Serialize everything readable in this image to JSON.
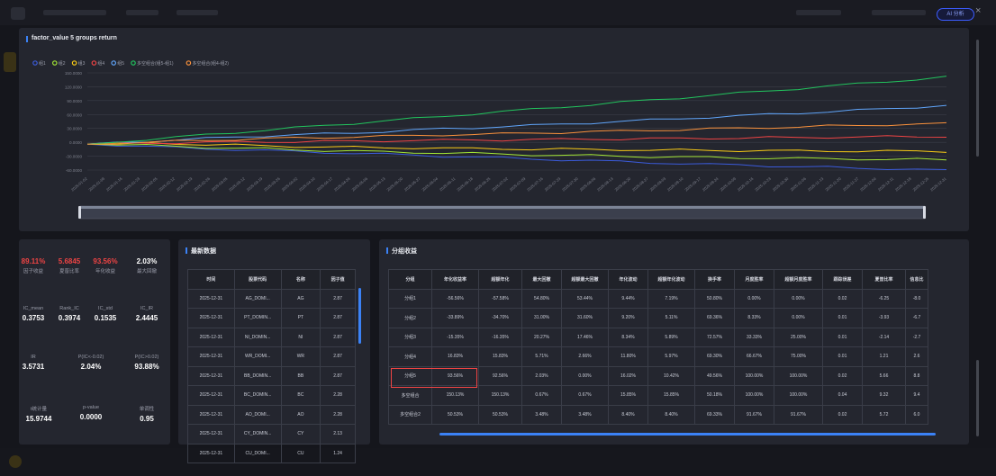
{
  "modal": {
    "analyze_label": "AI 分析",
    "close": "×"
  },
  "chart": {
    "title": "factor_value 5 groups return",
    "legend": [
      "组1",
      "组2",
      "组3",
      "组4",
      "组5",
      "多空组合(组5-组1)",
      "多空组合(组4-组2)"
    ],
    "y_ticks": [
      "150.0000",
      "120.0000",
      "90.0000",
      "60.0000",
      "30.0000",
      "0.0000",
      "-30.0000",
      "-60.0000"
    ],
    "x_ticks": [
      "2025-01-02",
      "2025-01-09",
      "2025-01-16",
      "2025-01-23",
      "2025-02-05",
      "2025-02-12",
      "2025-02-19",
      "2025-02-26",
      "2025-03-05",
      "2025-03-12",
      "2025-03-19",
      "2025-03-26",
      "2025-04-02",
      "2025-04-10",
      "2025-04-17",
      "2025-04-24",
      "2025-05-06",
      "2025-05-13",
      "2025-05-20",
      "2025-05-27",
      "2025-06-04",
      "2025-06-11",
      "2025-06-18",
      "2025-06-25",
      "2025-07-02",
      "2025-07-09",
      "2025-07-16",
      "2025-07-23",
      "2025-07-30",
      "2025-08-06",
      "2025-08-13",
      "2025-08-20",
      "2025-08-27",
      "2025-09-03",
      "2025-09-10",
      "2025-09-17",
      "2025-09-24",
      "2025-10-09",
      "2025-10-16",
      "2025-10-23",
      "2025-10-30",
      "2025-11-06",
      "2025-11-13",
      "2025-11-20",
      "2025-11-27",
      "2025-12-04",
      "2025-12-11",
      "2025-12-18",
      "2025-12-25",
      "2025-12-31"
    ]
  },
  "chart_data": {
    "type": "line",
    "title": "factor_value 5 groups return",
    "ylim": [
      -60,
      150
    ],
    "x_start": "2025-01-02",
    "x_end": "2025-12-31",
    "series": [
      {
        "name": "组1",
        "color": "#3b5bdb",
        "values": [
          0,
          -2,
          -5,
          -8,
          -10,
          -12,
          -14,
          -16,
          -18,
          -20,
          -22,
          -24,
          -26,
          -28,
          -30,
          -32,
          -34,
          -36,
          -38,
          -40,
          -42,
          -44,
          -45,
          -47,
          -49,
          -50,
          -52,
          -53,
          -55,
          -57
        ]
      },
      {
        "name": "组2",
        "color": "#a3e635",
        "values": [
          0,
          -1,
          -3,
          -5,
          -7,
          -9,
          -10,
          -12,
          -14,
          -15,
          -17,
          -18,
          -19,
          -20,
          -22,
          -23,
          -24,
          -25,
          -26,
          -27,
          -28,
          -29,
          -30,
          -30,
          -31,
          -32,
          -32,
          -33,
          -33,
          -34
        ]
      },
      {
        "name": "组3",
        "color": "#facc15",
        "values": [
          0,
          1,
          2,
          1,
          -1,
          -2,
          -4,
          -5,
          -6,
          -7,
          -8,
          -8,
          -9,
          -10,
          -10,
          -11,
          -11,
          -12,
          -12,
          -13,
          -13,
          -14,
          -14,
          -14,
          -15,
          -15,
          -15,
          -15,
          -16,
          -16
        ]
      },
      {
        "name": "组4",
        "color": "#ef4444",
        "values": [
          0,
          1,
          2,
          3,
          4,
          4,
          5,
          5,
          6,
          6,
          7,
          8,
          8,
          9,
          9,
          10,
          10,
          11,
          11,
          12,
          12,
          13,
          13,
          14,
          14,
          15,
          15,
          16,
          16,
          17
        ]
      },
      {
        "name": "组5",
        "color": "#60a5fa",
        "values": [
          0,
          3,
          6,
          9,
          12,
          15,
          18,
          20,
          22,
          24,
          27,
          30,
          33,
          35,
          38,
          40,
          43,
          46,
          49,
          52,
          55,
          58,
          61,
          64,
          67,
          70,
          73,
          76,
          80,
          84
        ]
      },
      {
        "name": "多空组合(组5-组1)",
        "color": "#22c55e",
        "values": [
          0,
          5,
          10,
          15,
          20,
          25,
          30,
          35,
          40,
          45,
          50,
          55,
          60,
          65,
          70,
          75,
          80,
          85,
          90,
          95,
          100,
          105,
          110,
          115,
          120,
          125,
          130,
          135,
          140,
          145
        ]
      },
      {
        "name": "多空组合(组4-组2)",
        "color": "#fb923c",
        "values": [
          0,
          2,
          4,
          6,
          8,
          10,
          12,
          13,
          14,
          16,
          17,
          18,
          20,
          21,
          22,
          24,
          25,
          27,
          28,
          30,
          31,
          33,
          34,
          36,
          37,
          39,
          40,
          42,
          43,
          44
        ]
      }
    ]
  },
  "stats": [
    {
      "value": "89.11%",
      "label": "因子收益",
      "red": true
    },
    {
      "value": "5.6845",
      "label": "夏普比率",
      "red": true
    },
    {
      "value": "93.56%",
      "label": "年化收益",
      "red": true
    },
    {
      "value": "2.03%",
      "label": "最大回撤",
      "red": false
    },
    {
      "value": "0.3753",
      "label": "IC_mean",
      "red": false
    },
    {
      "value": "0.3974",
      "label": "Rank_IC",
      "red": false
    },
    {
      "value": "0.1535",
      "label": "IC_std",
      "red": false
    },
    {
      "value": "2.4445",
      "label": "IC_IR",
      "red": false
    },
    {
      "value": "3.5731",
      "label": "IR",
      "red": false
    },
    {
      "value": "2.04%",
      "label": "P(IC<-0.02)",
      "red": false
    },
    {
      "value": "93.88%",
      "label": "P(IC>0.02)",
      "red": false
    },
    {
      "value": "15.9744",
      "label": "t统计量",
      "red": false
    },
    {
      "value": "0.0000",
      "label": "p-value",
      "red": false
    },
    {
      "value": "0.95",
      "label": "单调性",
      "red": false
    }
  ],
  "latest": {
    "title": "最新数据",
    "headers": [
      "时间",
      "股票代码",
      "名称",
      "因子值"
    ],
    "rows": [
      [
        "2025-12-31",
        "AG_DOMI...",
        "AG",
        "2.87"
      ],
      [
        "2025-12-31",
        "PT_DOMIN...",
        "PT",
        "2.87"
      ],
      [
        "2025-12-31",
        "NI_DOMIN...",
        "NI",
        "2.87"
      ],
      [
        "2025-12-31",
        "WR_DOMI...",
        "WR",
        "2.87"
      ],
      [
        "2025-12-31",
        "BB_DOMIN...",
        "BB",
        "2.87"
      ],
      [
        "2025-12-31",
        "BC_DOMIN...",
        "BC",
        "2.28"
      ],
      [
        "2025-12-31",
        "AO_DOMI...",
        "AO",
        "2.28"
      ],
      [
        "2025-12-31",
        "CY_DOMIN...",
        "CY",
        "2.13"
      ],
      [
        "2025-12-31",
        "CU_DOMI...",
        "CU",
        "1.24"
      ]
    ]
  },
  "group": {
    "title": "分组收益",
    "headers": [
      "分组",
      "年化收益率",
      "超额年化",
      "最大回撤",
      "超额最大回撤",
      "年化波动",
      "超额年化波动",
      "换手率",
      "月度胜率",
      "超额月度胜率",
      "跟踪误差",
      "夏普比率",
      "信息比"
    ],
    "rows": [
      [
        "分组1",
        "-56.56%",
        "-57.58%",
        "54.80%",
        "53.44%",
        "9.44%",
        "7.19%",
        "50.80%",
        "0.00%",
        "0.00%",
        "0.02",
        "-6.25",
        "-8.0"
      ],
      [
        "分组2",
        "-33.89%",
        "-34.70%",
        "31.00%",
        "31.60%",
        "9.20%",
        "5.11%",
        "69.36%",
        "8.33%",
        "0.00%",
        "0.01",
        "-3.93",
        "-6.7"
      ],
      [
        "分组3",
        "-15.35%",
        "-16.35%",
        "20.27%",
        "17.46%",
        "8.34%",
        "5.89%",
        "72.57%",
        "33.33%",
        "25.00%",
        "0.01",
        "-2.14",
        "-2.7"
      ],
      [
        "分组4",
        "16.83%",
        "15.83%",
        "5.71%",
        "2.66%",
        "11.80%",
        "5.97%",
        "69.30%",
        "66.67%",
        "75.00%",
        "0.01",
        "1.21",
        "2.6"
      ],
      [
        "分组5",
        "93.56%",
        "92.56%",
        "2.03%",
        "0.00%",
        "16.02%",
        "10.42%",
        "49.56%",
        "100.00%",
        "100.00%",
        "0.02",
        "5.66",
        "8.8"
      ],
      [
        "多空组合",
        "150.13%",
        "150.13%",
        "0.67%",
        "0.67%",
        "15.85%",
        "15.85%",
        "50.18%",
        "100.00%",
        "100.00%",
        "0.04",
        "9.32",
        "9.4"
      ],
      [
        "多空组合2",
        "50.53%",
        "50.53%",
        "3.48%",
        "3.48%",
        "8.40%",
        "8.40%",
        "69.33%",
        "91.67%",
        "91.67%",
        "0.02",
        "5.72",
        "6.0"
      ]
    ]
  }
}
